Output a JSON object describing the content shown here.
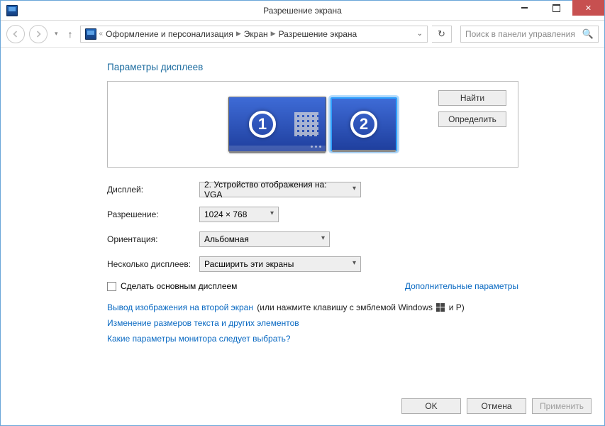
{
  "window": {
    "title": "Разрешение экрана"
  },
  "breadcrumb": {
    "items": [
      "Оформление и персонализация",
      "Экран",
      "Разрешение экрана"
    ]
  },
  "search": {
    "placeholder": "Поиск в панели управления"
  },
  "heading": "Параметры дисплеев",
  "preview": {
    "findBtn": "Найти",
    "identifyBtn": "Определить",
    "monitor1": "1",
    "monitor2": "2"
  },
  "form": {
    "displayLabel": "Дисплей:",
    "displayValue": "2. Устройство отображения на: VGA",
    "resolutionLabel": "Разрешение:",
    "resolutionValue": "1024 × 768",
    "orientationLabel": "Ориентация:",
    "orientationValue": "Альбомная",
    "multiLabel": "Несколько дисплеев:",
    "multiValue": "Расширить эти экраны",
    "makePrimary": "Сделать основным дисплеем",
    "advanced": "Дополнительные параметры"
  },
  "links": {
    "project": "Вывод изображения на второй экран",
    "projectTail1": " (или нажмите клавишу с эмблемой Windows ",
    "projectTail2": " и P)",
    "textSize": "Изменение размеров текста и других элементов",
    "help": "Какие параметры монитора следует выбрать?"
  },
  "buttons": {
    "ok": "OK",
    "cancel": "Отмена",
    "apply": "Применить"
  }
}
